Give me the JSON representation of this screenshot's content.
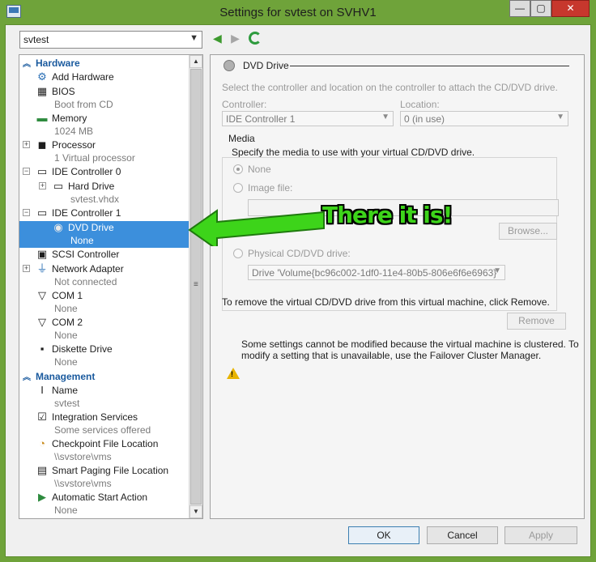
{
  "window": {
    "title": "Settings for svtest on SVHV1",
    "minimize": "—",
    "maximize": "▢",
    "close": "✕"
  },
  "vm_selector": {
    "value": "svtest"
  },
  "tree": {
    "hardware_header": "Hardware",
    "management_header": "Management",
    "items": [
      {
        "label": "Add Hardware",
        "sub": ""
      },
      {
        "label": "BIOS",
        "sub": "Boot from CD"
      },
      {
        "label": "Memory",
        "sub": "1024 MB"
      },
      {
        "label": "Processor",
        "sub": "1 Virtual processor"
      },
      {
        "label": "IDE Controller 0",
        "sub": ""
      },
      {
        "label": "Hard Drive",
        "sub": "svtest.vhdx"
      },
      {
        "label": "IDE Controller 1",
        "sub": ""
      },
      {
        "label": "DVD Drive",
        "sub": "None"
      },
      {
        "label": "SCSI Controller",
        "sub": ""
      },
      {
        "label": "Network Adapter",
        "sub": "Not connected"
      },
      {
        "label": "COM 1",
        "sub": "None"
      },
      {
        "label": "COM 2",
        "sub": "None"
      },
      {
        "label": "Diskette Drive",
        "sub": "None"
      }
    ],
    "management": [
      {
        "label": "Name",
        "sub": "svtest"
      },
      {
        "label": "Integration Services",
        "sub": "Some services offered"
      },
      {
        "label": "Checkpoint File Location",
        "sub": "\\\\svstore\\vms"
      },
      {
        "label": "Smart Paging File Location",
        "sub": "\\\\svstore\\vms"
      },
      {
        "label": "Automatic Start Action",
        "sub": "None"
      }
    ]
  },
  "panel": {
    "title": "DVD Drive",
    "description": "Select the controller and location on the controller to attach the CD/DVD drive.",
    "controller_label": "Controller:",
    "controller_value": "IDE Controller 1",
    "location_label": "Location:",
    "location_value": "0 (in use)",
    "media_label": "Media",
    "media_description": "Specify the media to use with your virtual CD/DVD drive.",
    "option_none": "None",
    "option_image": "Image file:",
    "browse_label": "Browse...",
    "option_physical": "Physical CD/DVD drive:",
    "physical_value": "Drive 'Volume{bc96c002-1df0-11e4-80b5-806e6f6e6963}'",
    "remove_text": "To remove the virtual CD/DVD drive from this virtual machine, click Remove.",
    "remove_label": "Remove",
    "warning_text_1": "Some settings cannot be modified because the virtual machine is clustered. To",
    "warning_text_2": "modify a setting that is unavailable, use the Failover Cluster Manager."
  },
  "buttons": {
    "ok": "OK",
    "cancel": "Cancel",
    "apply": "Apply"
  },
  "annotation": {
    "text": "There it is!"
  },
  "colors": {
    "frame": "#6fa33a",
    "selection": "#3c8fdc",
    "annotation": "#3dd41a",
    "header": "#1a5a9e"
  }
}
